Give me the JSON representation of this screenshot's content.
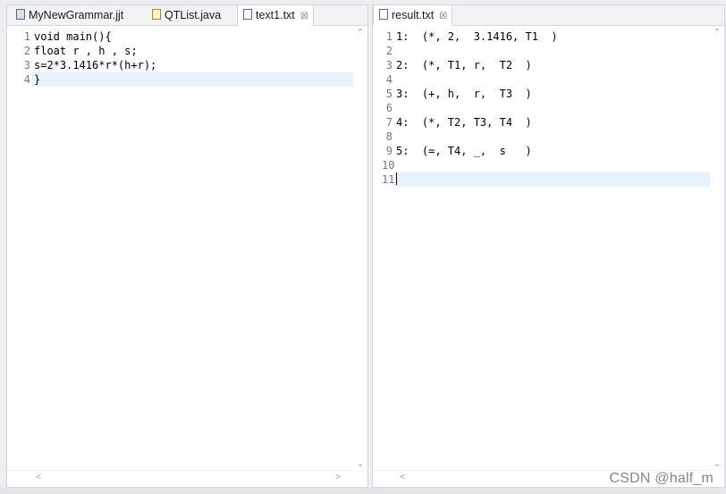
{
  "left_editor": {
    "tabs": [
      {
        "label": "MyNewGrammar.jjt",
        "icon": "jjt-file-icon"
      },
      {
        "label": "QTList.java",
        "icon": "java-file-icon"
      },
      {
        "label": "text1.txt",
        "icon": "text-file-icon",
        "close": "☒"
      }
    ],
    "line_numbers": [
      "1",
      "2",
      "3",
      "4"
    ],
    "lines": [
      "void main(){",
      "float r , h , s;",
      "s=2*3.1416*r*(h+r);",
      "}"
    ]
  },
  "right_editor": {
    "tabs": [
      {
        "label": "result.txt",
        "icon": "text-file-icon",
        "close": "☒"
      }
    ],
    "line_numbers": [
      "1",
      "2",
      "3",
      "4",
      "5",
      "6",
      "7",
      "8",
      "9",
      "10",
      "11"
    ],
    "lines": [
      "1:  (*, 2,  3.1416, T1  )",
      "",
      "2:  (*, T1, r,  T2  )",
      "",
      "3:  (+, h,  r,  T3  )",
      "",
      "4:  (*, T2, T3, T4  )",
      "",
      "5:  (=, T4, _,  s   )",
      "",
      ""
    ]
  },
  "scroll_arrows": {
    "up": "⌃",
    "down": "⌄",
    "left": "<",
    "right": ">"
  },
  "watermark": "CSDN @half_m",
  "colors": {
    "current_line": "#e8f2fe",
    "line_number": "#787878"
  }
}
